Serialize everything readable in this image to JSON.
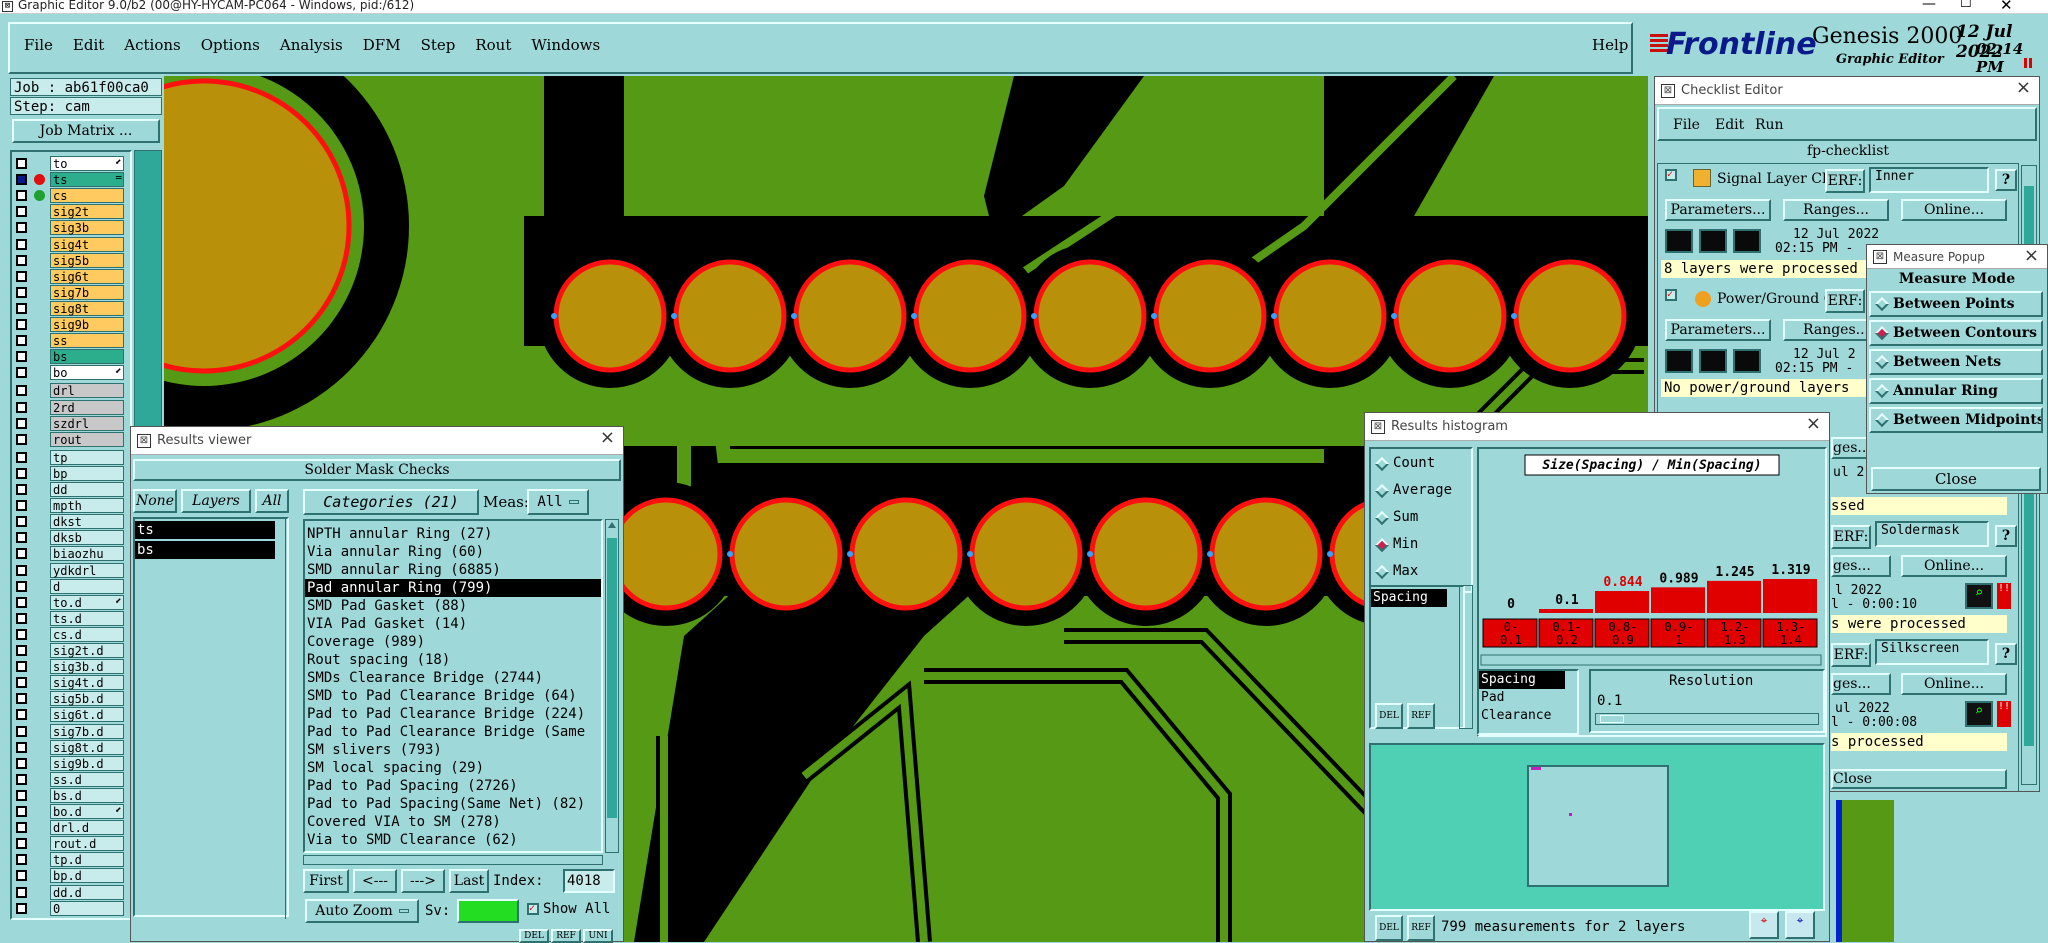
{
  "titlebar": {
    "text": "Graphic Editor 9.0/b2 (00@HY-HYCAM-PC064 - Windows, pid:/612)"
  },
  "menubar": {
    "items": [
      "File",
      "Edit",
      "Actions",
      "Options",
      "Analysis",
      "DFM",
      "Step",
      "Rout",
      "Windows"
    ],
    "help": "Help"
  },
  "brand": {
    "logo": "Frontline",
    "product": "Genesis 2000",
    "subtitle": "Graphic Editor",
    "date": "12 Jul 2022",
    "time": "02:14 PM"
  },
  "job": {
    "job": "Job : ab61f00ca0",
    "step": "Step: cam",
    "matrix": "Job Matrix ..."
  },
  "layers": [
    {
      "name": "to",
      "color": "#ffffff",
      "sym": "⬋"
    },
    {
      "name": "ts",
      "color": "#2cae8c",
      "sym": "="
    },
    {
      "name": "cs",
      "color": "#ffca60",
      "sym": ""
    },
    {
      "name": "sig2t",
      "color": "#ffca60",
      "sym": ""
    },
    {
      "name": "sig3b",
      "color": "#ffca60",
      "sym": ""
    },
    {
      "name": "sig4t",
      "color": "#ffca60",
      "sym": ""
    },
    {
      "name": "sig5b",
      "color": "#ffca60",
      "sym": ""
    },
    {
      "name": "sig6t",
      "color": "#ffca60",
      "sym": ""
    },
    {
      "name": "sig7b",
      "color": "#ffca60",
      "sym": ""
    },
    {
      "name": "sig8t",
      "color": "#ffca60",
      "sym": ""
    },
    {
      "name": "sig9b",
      "color": "#ffca60",
      "sym": ""
    },
    {
      "name": "ss",
      "color": "#ffca60",
      "sym": ""
    },
    {
      "name": "bs",
      "color": "#2cae8c",
      "sym": ""
    },
    {
      "name": "bo",
      "color": "#ffffff",
      "sym": "⬋"
    },
    {
      "name": "drl",
      "color": "#c8c8c8",
      "sym": ""
    },
    {
      "name": "2rd",
      "color": "#c8c8c8",
      "sym": ""
    },
    {
      "name": "szdrl",
      "color": "#c8c8c8",
      "sym": ""
    },
    {
      "name": "rout",
      "color": "#c8c8c8",
      "sym": ""
    },
    {
      "name": "tp",
      "color": "#c8ecec",
      "sym": ""
    },
    {
      "name": "bp",
      "color": "#c8ecec",
      "sym": ""
    },
    {
      "name": "dd",
      "color": "#c8ecec",
      "sym": ""
    },
    {
      "name": "mpth",
      "color": "#c8ecec",
      "sym": ""
    },
    {
      "name": "dkst",
      "color": "#c8ecec",
      "sym": ""
    },
    {
      "name": "dksb",
      "color": "#c8ecec",
      "sym": ""
    },
    {
      "name": "biaozhu",
      "color": "#c8ecec",
      "sym": ""
    },
    {
      "name": "ydkdrl",
      "color": "#c8ecec",
      "sym": ""
    },
    {
      "name": "d",
      "color": "#c8ecec",
      "sym": ""
    },
    {
      "name": "to.d",
      "color": "#c8ecec",
      "sym": "⬋"
    },
    {
      "name": "ts.d",
      "color": "#c8ecec",
      "sym": ""
    },
    {
      "name": "cs.d",
      "color": "#c8ecec",
      "sym": ""
    },
    {
      "name": "sig2t.d",
      "color": "#c8ecec",
      "sym": ""
    },
    {
      "name": "sig3b.d",
      "color": "#c8ecec",
      "sym": ""
    },
    {
      "name": "sig4t.d",
      "color": "#c8ecec",
      "sym": ""
    },
    {
      "name": "sig5b.d",
      "color": "#c8ecec",
      "sym": ""
    },
    {
      "name": "sig6t.d",
      "color": "#c8ecec",
      "sym": ""
    },
    {
      "name": "sig7b.d",
      "color": "#c8ecec",
      "sym": ""
    },
    {
      "name": "sig8t.d",
      "color": "#c8ecec",
      "sym": ""
    },
    {
      "name": "sig9b.d",
      "color": "#c8ecec",
      "sym": ""
    },
    {
      "name": "ss.d",
      "color": "#c8ecec",
      "sym": ""
    },
    {
      "name": "bs.d",
      "color": "#c8ecec",
      "sym": ""
    },
    {
      "name": "bo.d",
      "color": "#c8ecec",
      "sym": "⬋"
    },
    {
      "name": "drl.d",
      "color": "#c8ecec",
      "sym": ""
    },
    {
      "name": "rout.d",
      "color": "#c8ecec",
      "sym": ""
    },
    {
      "name": "tp.d",
      "color": "#c8ecec",
      "sym": ""
    },
    {
      "name": "bp.d",
      "color": "#c8ecec",
      "sym": ""
    },
    {
      "name": "dd.d",
      "color": "#c8ecec",
      "sym": ""
    },
    {
      "name": "0",
      "color": "#c8ecec",
      "sym": ""
    }
  ],
  "results_viewer": {
    "title": "Results viewer",
    "header": "Solder Mask Checks",
    "none": "None",
    "layers": "Layers",
    "all": "All",
    "layer_list": [
      "ts",
      "bs"
    ],
    "categories_btn": "Categories (21)",
    "meas_label": "Meas:",
    "meas_value": "All",
    "categories": [
      "NPTH annular Ring (27)",
      "Via annular Ring (60)",
      "SMD annular Ring (6885)",
      "Pad annular Ring (799)",
      "SMD Pad Gasket (88)",
      "VIA Pad Gasket (14)",
      "Coverage (989)",
      "Rout spacing (18)",
      "SMDs Clearance Bridge (2744)",
      "SMD to Pad Clearance Bridge (64)",
      "Pad to Pad Clearance Bridge (224)",
      "Pad to Pad Clearance Bridge (Same",
      "SM slivers (793)",
      "SM local spacing (29)",
      "Pad to Pad Spacing (2726)",
      "Pad to Pad Spacing(Same Net) (82)",
      "Covered VIA to SM (278)",
      "Via to SMD Clearance (62)"
    ],
    "selected_index": 3,
    "first": "First",
    "prev": "<---",
    "next": "--->",
    "last": "Last",
    "index_label": "Index:",
    "index_value": "4018",
    "auto_zoom": "Auto Zoom",
    "sv_label": "Sv:",
    "show_all": "Show All",
    "bottom_btns": [
      "DEL",
      "REF",
      "UNI"
    ]
  },
  "checklist": {
    "title": "Checklist Editor",
    "menu": [
      "File",
      "Edit",
      "Run"
    ],
    "name": "fp-checklist",
    "items": [
      {
        "label": "Signal Layer Ch",
        "erf": "ERF:",
        "erf_value": "Inner",
        "date": "12 Jul 2022",
        "time": "02:15 PM -",
        "status": "8 layers were processed"
      },
      {
        "label": "Power/Ground C",
        "erf": "ERF:",
        "erf_value": "",
        "date": "12 Jul 2",
        "time": "02:15 PM -",
        "status": "No power/ground layers"
      }
    ],
    "params": "Parameters...",
    "ranges": "Ranges...",
    "online": "Online...",
    "partial": [
      {
        "ranges": "ges...",
        "date": "ul 2",
        "status": "ssed",
        "erf": "ERF:",
        "erf_value": "Soldermask",
        "online": "Online...",
        "date2": "l 2022",
        "time": "l - 0:00:10",
        "status2": "s were processed"
      },
      {
        "ranges": "ges...",
        "erf": "ERF:",
        "erf_value": "Silkscreen",
        "online": "Online...",
        "date": "ul 2022",
        "time": "l - 0:00:08",
        "status": "s processed"
      }
    ],
    "close": "Close"
  },
  "measure": {
    "title": "Measure Popup",
    "mode": "Measure Mode",
    "options": [
      "Between Points",
      "Between Contours",
      "Between Nets",
      "Annular Ring",
      "Between Midpoints"
    ],
    "selected": 1,
    "close": "Close"
  },
  "histogram": {
    "title": "Results histogram",
    "options": [
      "Count",
      "Average",
      "Sum",
      "Min",
      "Max"
    ],
    "selected": 3,
    "list": [
      "Spacing"
    ],
    "chart_title": "Size(Spacing) / Min(Spacing)",
    "bottom_list": [
      "Spacing",
      "Pad",
      "Clearance"
    ],
    "resolution_label": "Resolution",
    "resolution_value": "0.1",
    "status": "799 measurements for 2 layers",
    "btns": [
      "DEL",
      "REF"
    ]
  },
  "chart_data": {
    "type": "bar",
    "title": "Size(Spacing) / Min(Spacing)",
    "categories": [
      "0-0.1",
      "0.1-0.2",
      "0.8-0.9",
      "0.9-1",
      "1.2-1.3",
      "1.3-1.4"
    ],
    "values": [
      0,
      0.1,
      0.844,
      0.989,
      1.245,
      1.319
    ],
    "value_labels": [
      "0",
      "0.1",
      "0.844",
      "0.989",
      "1.245",
      "1.319"
    ],
    "bar_color": "#e00000"
  },
  "colors": {
    "bg": "#9fd8d8",
    "copper": "#559914",
    "pad": "#b8900a",
    "pad_outline": "#ff1010",
    "mask": "#000000"
  }
}
